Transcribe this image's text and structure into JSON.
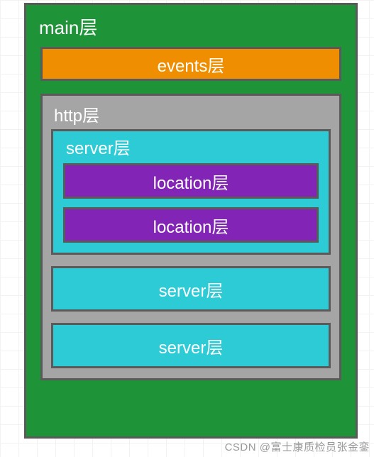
{
  "main": {
    "title": "main层"
  },
  "events": {
    "label": "events层"
  },
  "http": {
    "title": "http层",
    "servers": [
      {
        "title": "server层",
        "locations": [
          {
            "label": "location层"
          },
          {
            "label": "location层"
          }
        ]
      },
      {
        "title": "server层"
      },
      {
        "title": "server层"
      }
    ]
  },
  "watermark": "CSDN @富士康质检员张金銮",
  "colors": {
    "main": "#1E9338",
    "events": "#EF8E00",
    "http": "#A5A5A5",
    "server": "#2CCBD5",
    "location": "#8224B6",
    "border": "#5A5A5A"
  }
}
